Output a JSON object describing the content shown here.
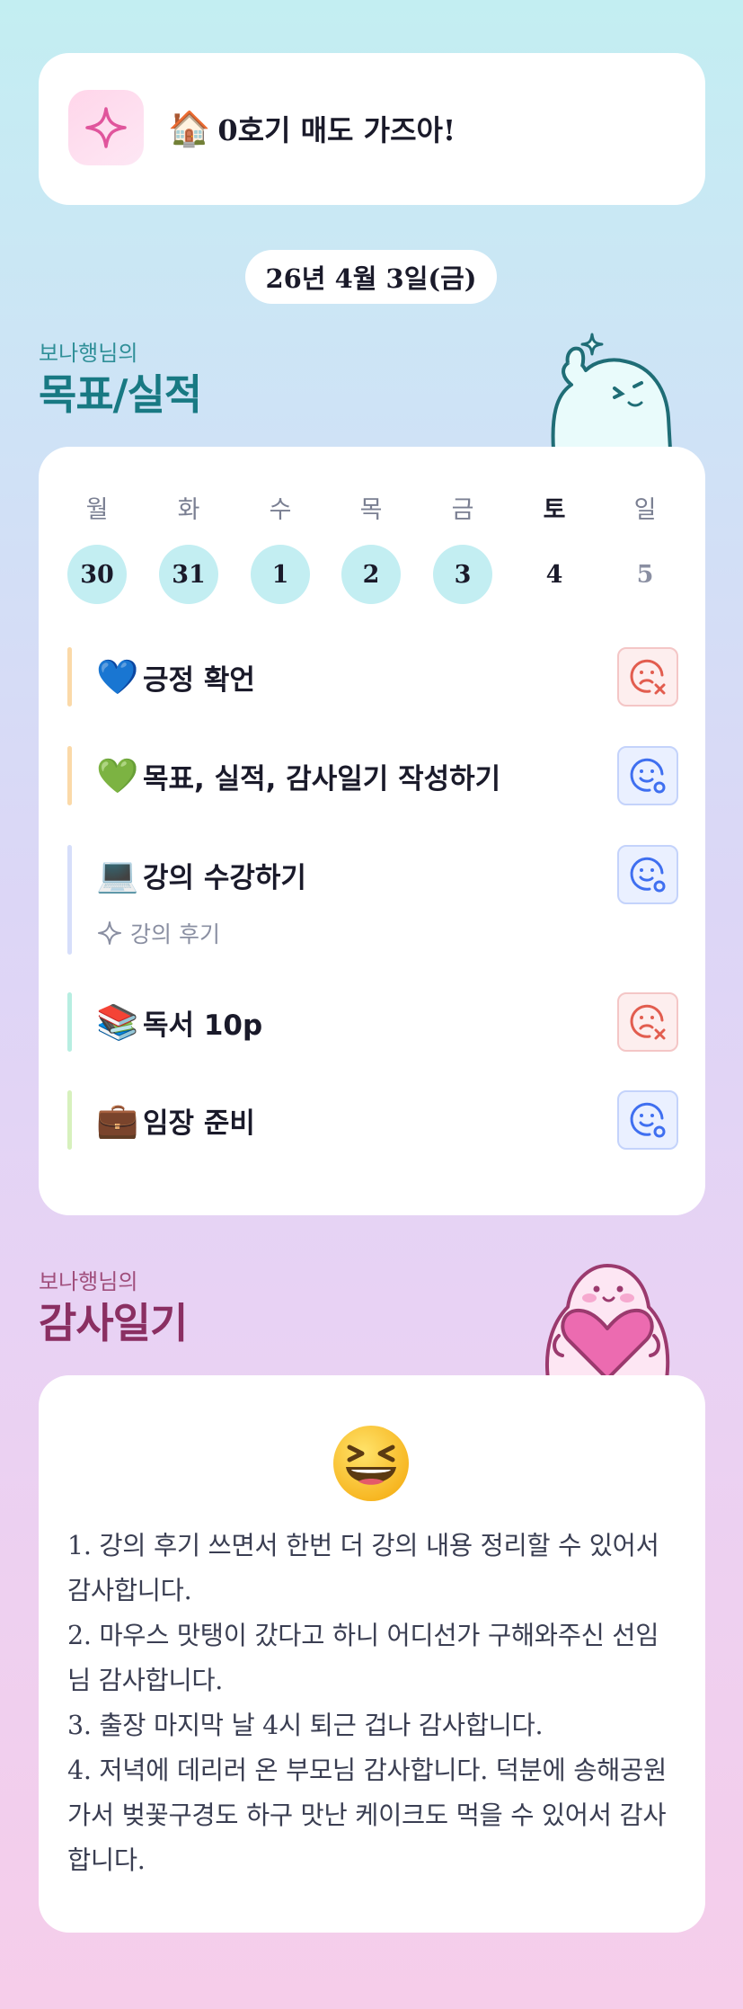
{
  "banner": {
    "icon": "sparkle-icon",
    "house_emoji": "🏠",
    "title": "0호기 매도 가즈아!"
  },
  "date": "26년 4월 3일(금)",
  "goals_section": {
    "subtitle": "보나행님의",
    "title": "목표/실적"
  },
  "week": {
    "days": [
      "월",
      "화",
      "수",
      "목",
      "금",
      "토",
      "일"
    ],
    "dates": [
      "30",
      "31",
      "1",
      "2",
      "3",
      "4",
      "5"
    ],
    "status": [
      "done",
      "done",
      "done",
      "done",
      "done",
      "today",
      "future"
    ]
  },
  "goals": [
    {
      "emoji": "💙",
      "label": "긍정 확언",
      "bar_color": "#fbd9a8",
      "status": "fail"
    },
    {
      "emoji": "💚",
      "label": "목표, 실적, 감사일기 작성하기",
      "bar_color": "#fbd9a8",
      "status": "ok"
    },
    {
      "emoji": "💻",
      "label": "강의 수강하기",
      "bar_color": "#d6defa",
      "status": "ok",
      "sub": "강의 후기"
    },
    {
      "emoji": "📚",
      "label": "독서 10p",
      "bar_color": "#b7eee1",
      "status": "fail"
    },
    {
      "emoji": "💼",
      "label": "임장 준비",
      "bar_color": "#d7f1bd",
      "status": "ok"
    }
  ],
  "gratitude_section": {
    "subtitle": "보나행님의",
    "title": "감사일기"
  },
  "gratitude": {
    "mood_icon": "laughing-face-icon",
    "lines": [
      "1. 강의 후기 쓰면서 한번 더 강의 내용 정리할 수 있어서 감사합니다.",
      "2. 마우스 맛탱이 갔다고 하니 어디선가 구해와주신 선임님 감사합니다.",
      "3. 출장 마지막 날 4시 퇴근 겁나 감사합니다.",
      "4. 저녁에 데리러 온 부모님 감사합니다. 덕분에 송해공원 가서 벚꽃구경도 하구 맛난 케이크도 먹을 수 있어서 감사합니다."
    ]
  },
  "colors": {
    "teal_title": "#187983",
    "plum_title": "#8a2f62",
    "done_circle": "#c3eef2",
    "fail_icon": "#e25d4f",
    "ok_icon": "#3f6ff0"
  }
}
